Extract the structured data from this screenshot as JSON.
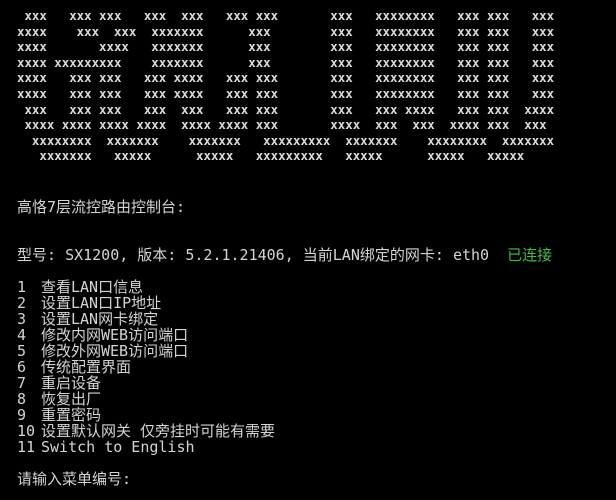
{
  "banner_art": " xxx   xxx xxx   xxx  xxx   xxx xxx       xxx   xxxxxxxx   xxx xxx   xxx\nxxxx    xxx  xxx  xxxxxxx      xxx        xxx   xxxxxxxx   xxx xxx   xxx\nxxxx       xxxx   xxxxxxx      xxx        xxx   xxxxxxxx   xxx xxx   xxx\nxxxx xxxxxxxxx    xxxxxxx      xxx        xxx   xxxxxxxx   xxx xxx   xxx\nxxxx   xxx xxx   xxx xxxx   xxx xxx       xxx   xxxxxxxx   xxx xxx   xxx\nxxxx   xxx xxx   xxx xxxx   xxx xxx       xxx   xxxxxxxx   xxx xxx   xxx\n xxx   xxx xxx   xxx  xxx   xxx xxx       xxx   xxx xxxx   xxx xxx  xxxx\n xxxx xxxx xxxx xxxx  xxxx xxxx xxx       xxxx  xxx  xxx  xxxx xxx  xxx\n  xxxxxxxx  xxxxxxx    xxxxxxx   xxxxxxxxx  xxxxxxx    xxxxxxxx  xxxxxxx\n   xxxxxxx   xxxxx      xxxxx   xxxxxxxxx   xxxxx      xxxxx   xxxxx",
  "console_title": "高恪7层流控路由控制台:",
  "device": {
    "model_label": "型号: ",
    "model": "SX1200",
    "version_label": ", 版本: ",
    "version": "5.2.1.21406",
    "lan_label": ", 当前LAN绑定的网卡: ",
    "lan_nic": "eth0",
    "connection_status": "已连接",
    "connection_status_color": "#3fbf3f"
  },
  "menu": [
    {
      "num": "1",
      "label": "查看LAN口信息"
    },
    {
      "num": "2",
      "label": "设置LAN口IP地址"
    },
    {
      "num": "3",
      "label": "设置LAN网卡绑定"
    },
    {
      "num": "4",
      "label": "修改内网WEB访问端口"
    },
    {
      "num": "5",
      "label": "修改外网WEB访问端口"
    },
    {
      "num": "6",
      "label": "传统配置界面"
    },
    {
      "num": "7",
      "label": "重启设备"
    },
    {
      "num": "8",
      "label": "恢复出厂"
    },
    {
      "num": "9",
      "label": "重置密码"
    },
    {
      "num": "10",
      "label": "设置默认网关 仅旁挂时可能有需要"
    },
    {
      "num": "11",
      "label": "Switch to English"
    }
  ],
  "prompt": "请输入菜单编号:"
}
